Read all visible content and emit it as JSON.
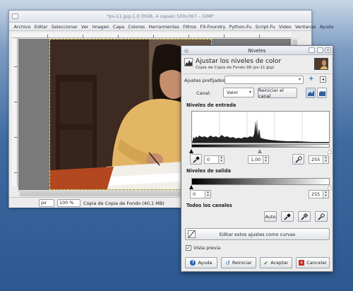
{
  "gimp": {
    "title": "*ps-11.jpg-1.0 (RGB, 4 capas) 500x367 – GIMP",
    "menu": [
      "Archivo",
      "Editar",
      "Seleccionar",
      "Ver",
      "Imagen",
      "Capa",
      "Colores",
      "Herramientas",
      "Filtros",
      "FX-Foundry",
      "Python-Fu",
      "Script-Fu",
      "Video",
      "Ventanas",
      "Ayuda"
    ],
    "status": {
      "unit": "px",
      "zoom": "100 %",
      "text": "Copia de Copia de Fondo (40,1 MB)"
    }
  },
  "dialog": {
    "title": "Niveles",
    "heading": "Ajustar los niveles de color",
    "subheading": "Copia de Copia de Fondo-38 (ps-11.jpg)",
    "presets_label": "Ajustes prefijados:",
    "channel_label": "Canal:",
    "channel_value": "Valor",
    "reset_channel": "Reiniciar el canal",
    "input_levels": "Niveles de entrada",
    "input_low": "0",
    "input_gamma": "1,00",
    "input_high": "255",
    "output_levels": "Niveles de salida",
    "output_low": "0",
    "output_high": "255",
    "all_channels": "Todos los canales",
    "auto": "Auto",
    "edit_curves": "Editar estos ajustes como curvas",
    "preview_label": "Vista previa",
    "preview_checked": true,
    "help": "Ayuda",
    "reset": "Reiniciar",
    "ok": "Aceptar",
    "cancel": "Cancelar"
  },
  "colors": {
    "sweater": "#e2b664",
    "desktop_blue": "#3e6aa0",
    "ok_green": "#2e9b2e",
    "cancel_red": "#c8281e"
  }
}
